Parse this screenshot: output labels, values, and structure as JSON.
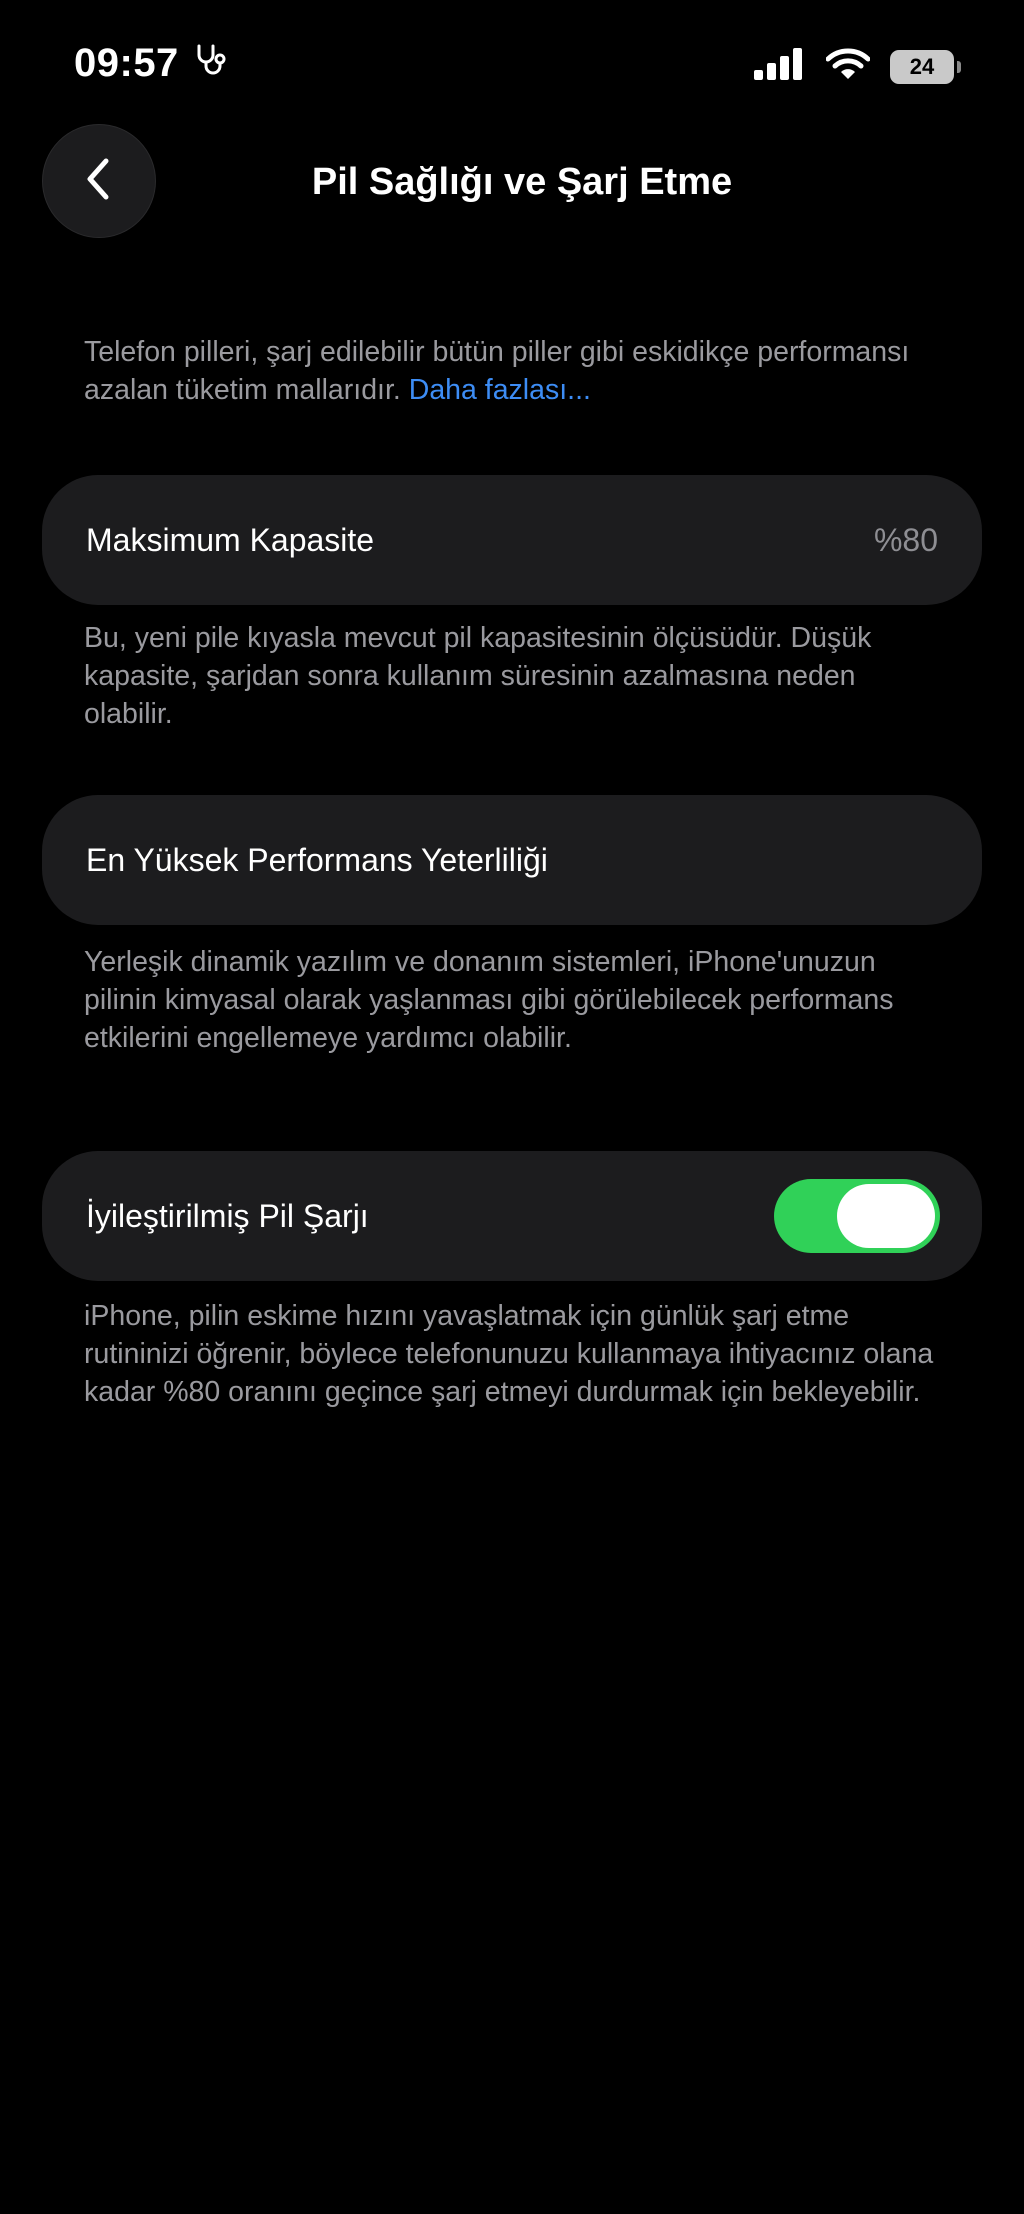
{
  "status_bar": {
    "time": "09:57",
    "battery_level": "24"
  },
  "header": {
    "title": "Pil Sağlığı ve Şarj Etme"
  },
  "intro": {
    "text": "Telefon pilleri, şarj edilebilir bütün piller gibi eskidikçe performansı azalan tüketim mallarıdır.",
    "link": "Daha fazlası..."
  },
  "max_capacity": {
    "label": "Maksimum Kapasite",
    "value": "%80",
    "footnote": "Bu, yeni pile kıyasla mevcut pil kapasitesinin ölçüsüdür. Düşük kapasite, şarjdan sonra kullanım süresinin azalmasına neden olabilir."
  },
  "peak_performance": {
    "label": "En Yüksek Performans Yeterliliği",
    "footnote": "Yerleşik dinamik yazılım ve donanım sistemleri, iPhone'unuzun pilinin kimyasal olarak yaşlanması gibi görülebilecek performans etkilerini engellemeye yardımcı olabilir."
  },
  "optimized_charging": {
    "label": "İyileştirilmiş Pil Şarjı",
    "enabled": true,
    "footnote": "iPhone, pilin eskime hızını yavaşlatmak için günlük şarj etme rutininizi öğrenir, böylece telefonunuzu kullanmaya ihtiyacınız olana kadar %80 oranını geçince şarj etmeyi durdurmak için bekleyebilir."
  },
  "colors": {
    "background": "#000000",
    "card": "#1c1c1e",
    "toggle_on": "#30d158",
    "link": "#3d8df5",
    "secondary_text": "#9a9a9f"
  },
  "icons": [
    "stethoscope-icon",
    "cellular-signal-icon",
    "wifi-icon",
    "battery-icon",
    "chevron-left-icon"
  ]
}
